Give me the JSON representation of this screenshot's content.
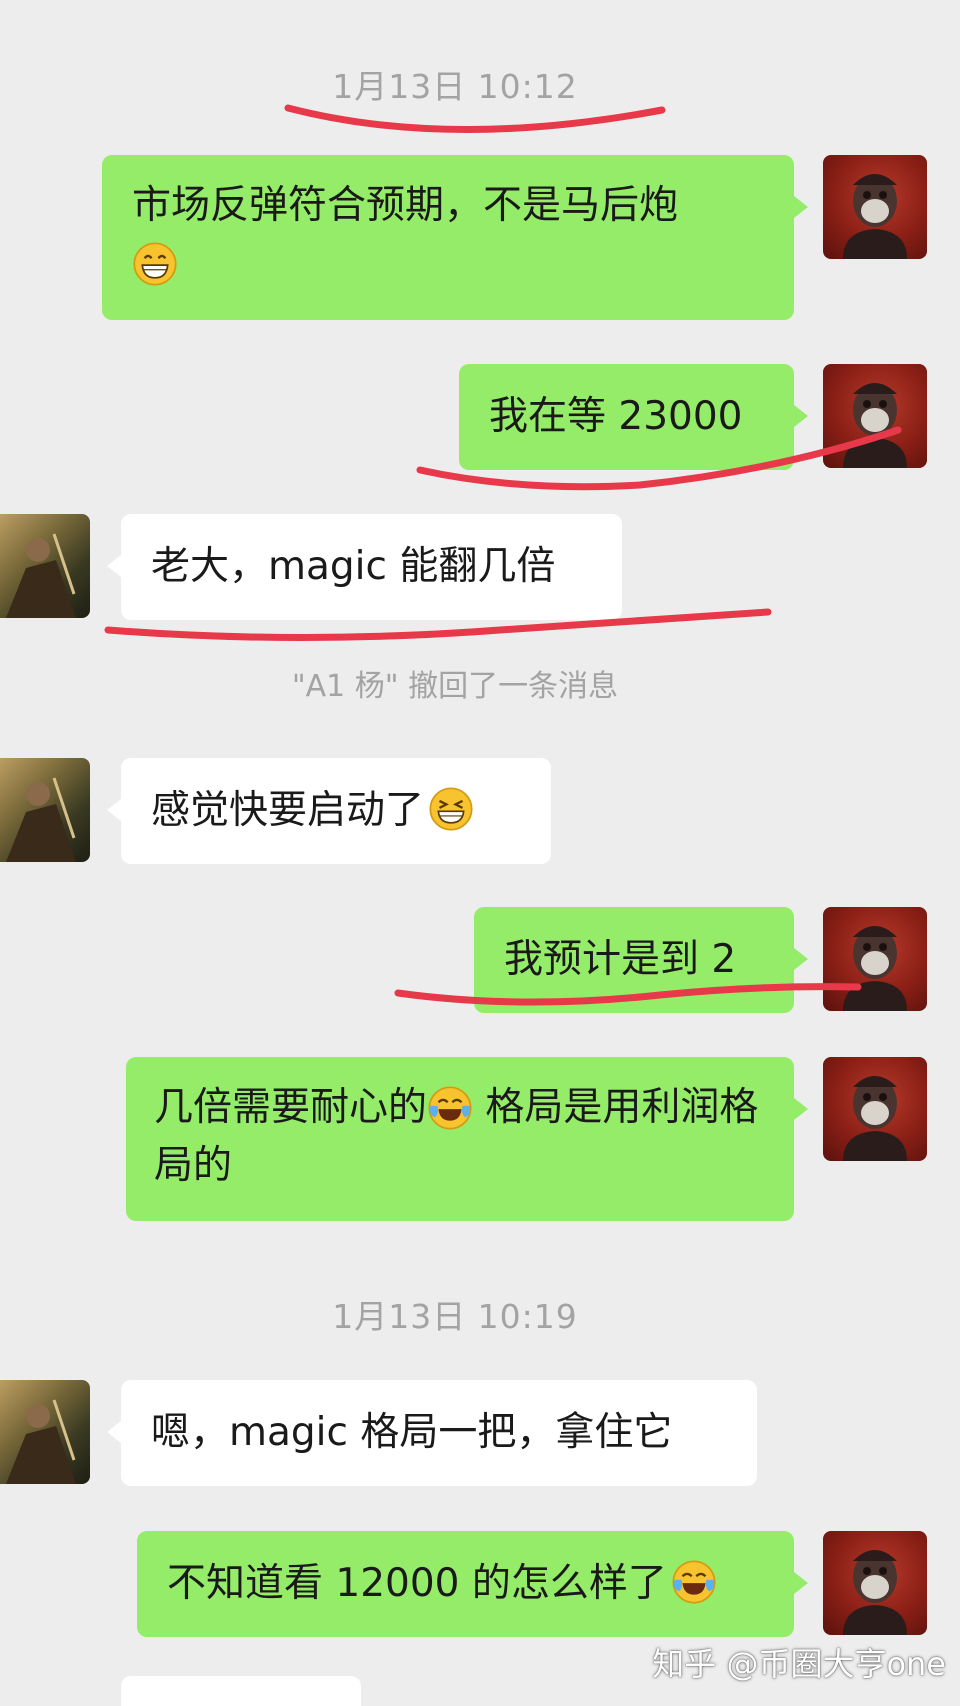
{
  "timestamps": {
    "first": "1月13日 10:12",
    "second": "1月13日 10:19"
  },
  "messages": [
    {
      "side": "out",
      "text": "市场反弹符合预期，不是马后炮",
      "emoji": "grin-emoji"
    },
    {
      "side": "out",
      "text": "我在等 23000"
    },
    {
      "side": "in",
      "text": "老大，magic 能翻几倍"
    },
    {
      "side": "in",
      "text": "感觉快要启动了",
      "emoji": "grin-squint-emoji"
    },
    {
      "side": "out",
      "text": "我预计是到 2"
    },
    {
      "side": "out",
      "text_a": "几倍需要耐心的",
      "text_b": " 格局是用利润格局的",
      "emoji": "laugh-cry-emoji"
    },
    {
      "side": "in",
      "text": "嗯，magic 格局一把，拿住它"
    },
    {
      "side": "out",
      "text": "不知道看 12000 的怎么样了",
      "emoji": "laugh-cry-emoji"
    }
  ],
  "recall_notice": "\"A1 杨\" 撤回了一条消息",
  "watermark": "知乎 @币圈大亨one",
  "colors": {
    "background": "#ededed",
    "outgoing_bubble": "#95ec69",
    "incoming_bubble": "#ffffff",
    "timestamp_text": "#a3a3a3",
    "annotation_red": "#e8394a"
  },
  "icons": {
    "self_avatar": "ape-avatar",
    "other_avatar": "warrior-avatar"
  }
}
